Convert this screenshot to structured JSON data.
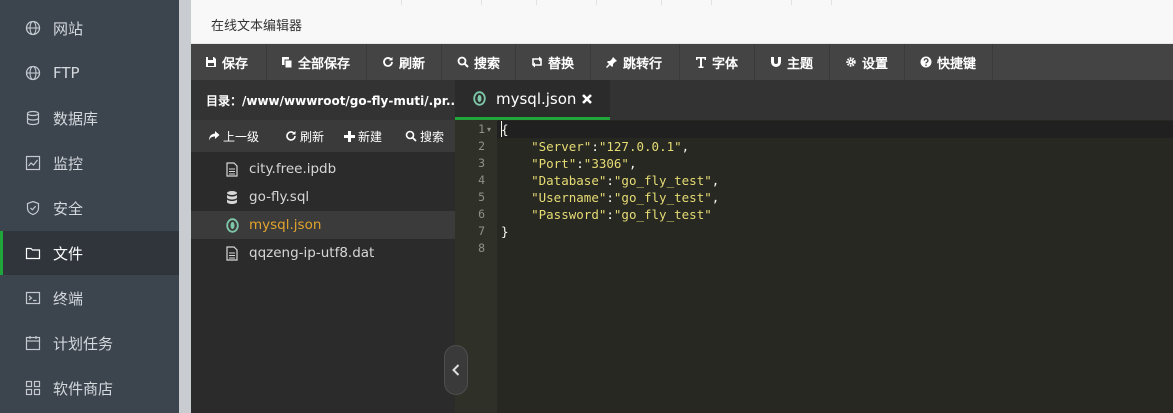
{
  "nav": {
    "items": [
      {
        "label": "网站",
        "icon": "globe-icon"
      },
      {
        "label": "FTP",
        "icon": "globe-icon"
      },
      {
        "label": "数据库",
        "icon": "database-icon"
      },
      {
        "label": "监控",
        "icon": "monitor-icon"
      },
      {
        "label": "安全",
        "icon": "shield-icon"
      },
      {
        "label": "文件",
        "icon": "folder-icon",
        "active": true
      },
      {
        "label": "终端",
        "icon": "terminal-icon"
      },
      {
        "label": "计划任务",
        "icon": "calendar-icon"
      },
      {
        "label": "软件商店",
        "icon": "grid-icon"
      }
    ]
  },
  "window": {
    "title": "在线文本编辑器"
  },
  "toolbar": {
    "save": "保存",
    "save_all": "全部保存",
    "refresh": "刷新",
    "search": "搜索",
    "replace": "替换",
    "goto_line": "跳转行",
    "font": "字体",
    "theme": "主题",
    "settings": "设置",
    "shortcuts": "快捷键"
  },
  "file_panel": {
    "path": "目录：/www/wwwroot/go-fly-muti/.pr...",
    "up": "上一级",
    "refresh": "刷新",
    "new": "新建",
    "search": "搜索",
    "files": [
      {
        "name": "city.free.ipdb",
        "icon": "file-icon"
      },
      {
        "name": "go-fly.sql",
        "icon": "database-icon"
      },
      {
        "name": "mysql.json",
        "icon": "json-icon",
        "selected": true
      },
      {
        "name": "qqzeng-ip-utf8.dat",
        "icon": "file-icon"
      }
    ]
  },
  "editor": {
    "tab_label": "mysql.json",
    "line_numbers": [
      "1",
      "2",
      "3",
      "4",
      "5",
      "6",
      "7",
      "8"
    ],
    "lines": [
      {
        "text": "{"
      },
      {
        "key": "\"Server\"",
        "val": "\"127.0.0.1\"",
        "trail": ","
      },
      {
        "key": "\"Port\"",
        "val": "\"3306\"",
        "trail": ","
      },
      {
        "key": "\"Database\"",
        "val": "\"go_fly_test\"",
        "trail": ","
      },
      {
        "key": "\"Username\"",
        "val": "\"go_fly_test\"",
        "trail": ","
      },
      {
        "key": "\"Password\"",
        "val": "\"go_fly_test\"",
        "trail": ""
      },
      {
        "text": "}"
      },
      {
        "text": ""
      }
    ]
  },
  "colors": {
    "accent": "#20a53a",
    "selected_file": "#e2a32c",
    "string": "#e6db74"
  }
}
